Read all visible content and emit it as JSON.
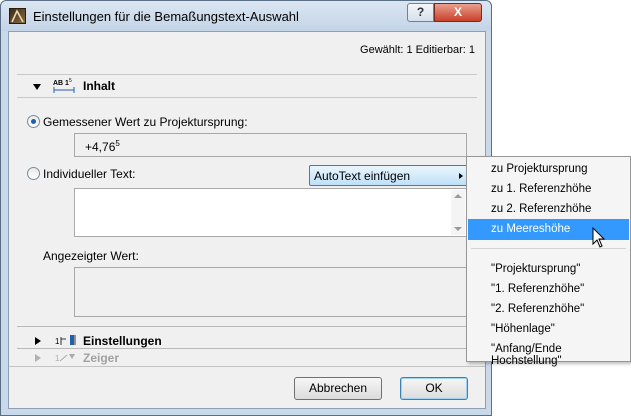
{
  "window": {
    "title": "Einstellungen für die Bemaßungstext-Auswahl",
    "help_label": "?",
    "close_label": "X"
  },
  "selection_info": "Gewählt: 1 Editierbar: 1",
  "sections": {
    "inhalt": "Inhalt",
    "einstellungen": "Einstellungen",
    "zeiger": "Zeiger"
  },
  "content": {
    "measured_label": "Gemessener Wert zu Projektursprung:",
    "measured_value": "+4,76",
    "measured_value_sup": "5",
    "custom_label": "Individueller Text:",
    "autotext_button": "AutoText einfügen",
    "displayed_label": "Angezeigter Wert:"
  },
  "buttons": {
    "cancel": "Abbrechen",
    "ok": "OK"
  },
  "autotext_menu": {
    "group1": [
      "zu Projektursprung",
      "zu 1. Referenzhöhe",
      "zu 2. Referenzhöhe",
      "zu Meereshöhe"
    ],
    "group2": [
      "\"Projektursprung\"",
      "\"1. Referenzhöhe\"",
      "\"2. Referenzhöhe\"",
      "\"Höhenlage\"",
      "\"Anfang/Ende Hochstellung\""
    ],
    "highlighted": "zu Meereshöhe"
  },
  "colors": {
    "highlight": "#3399ff",
    "accent_border": "#3c7fb1"
  }
}
